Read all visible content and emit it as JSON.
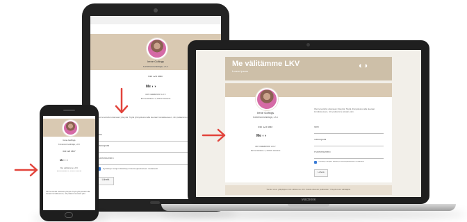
{
  "brand": {
    "name": "Me välitämme LKV",
    "subtitle": "Lorem ipsum"
  },
  "agent": {
    "name": "Irene Gofings",
    "title": "Kiinteistönvälittäjä, LKV",
    "phone": "040 123 4567",
    "office": "Me välitämme LKV",
    "address": "Esimerkkikatu 1, 00100 Helsinki"
  },
  "form": {
    "intro": "Olet tervetullut ottamaan yhteyttä. Täytä yhteystietosi alla olevaan lomakkeeseen, niin palaamme asiaan pian.",
    "name_label": "Nimi",
    "email_label": "Sähköposti",
    "phone_label": "Puhelinnumero",
    "consent_label": "Hyväksyn tietojeni käsittelyn tietosuojaselosteen mukaisesti",
    "submit_label": "Lähetä"
  },
  "footer": {
    "text": "Tämän sivun ylläpitäjä on Me välitämme LKV. Kaikki oikeudet pidätetään. Yhteydenotot välittäjälle."
  },
  "device": {
    "laptop_label": "MacBook"
  },
  "colors": {
    "banner": "#d9c9b2",
    "header": "#cdbfa8",
    "arrow": "#e2433b"
  }
}
